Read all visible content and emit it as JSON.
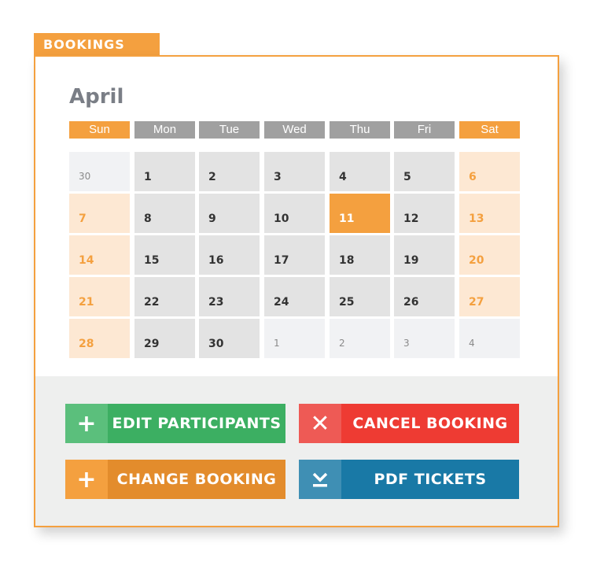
{
  "header": {
    "tab_label": "BOOKINGS"
  },
  "calendar": {
    "month": "April",
    "weekdays": [
      "Sun",
      "Mon",
      "Tue",
      "Wed",
      "Thu",
      "Fri",
      "Sat"
    ],
    "weeks": [
      [
        "30",
        "1",
        "2",
        "3",
        "4",
        "5",
        "6"
      ],
      [
        "7",
        "8",
        "9",
        "10",
        "11",
        "12",
        "13"
      ],
      [
        "14",
        "15",
        "16",
        "17",
        "18",
        "19",
        "20"
      ],
      [
        "21",
        "22",
        "23",
        "24",
        "25",
        "26",
        "27"
      ],
      [
        "28",
        "29",
        "30",
        "1",
        "2",
        "3",
        "4"
      ]
    ],
    "selected_day": "11"
  },
  "actions": {
    "edit": {
      "label": "EDIT PARTICIPANTS",
      "icon": "plus-icon",
      "icon_glyph": "+"
    },
    "cancel": {
      "label": "CANCEL BOOKING",
      "icon": "close-icon",
      "icon_glyph": "✕"
    },
    "change": {
      "label": "CHANGE BOOKING",
      "icon": "plus-icon",
      "icon_glyph": "+"
    },
    "pdf": {
      "label": "PDF TICKETS",
      "icon": "download-icon"
    }
  },
  "colors": {
    "accent": "#f4a03f",
    "green": "#3caf62",
    "red": "#ee3b33",
    "blue": "#1979a6"
  }
}
